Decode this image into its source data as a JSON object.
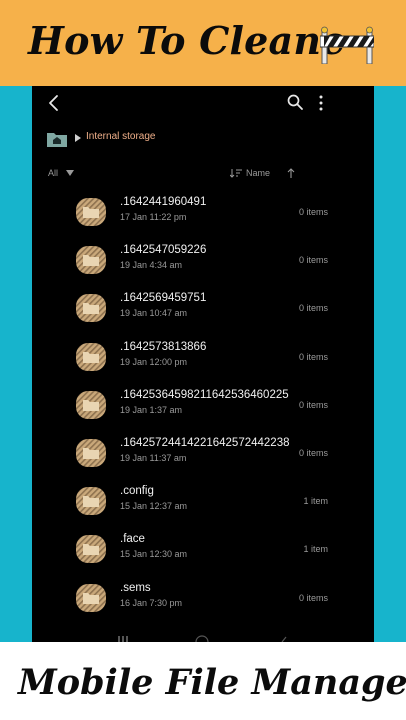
{
  "banner_top": {
    "title": "How To Cleane",
    "icon": "road-barrier-icon"
  },
  "banner_bottom": {
    "title": "Mobile File Manager"
  },
  "colors": {
    "accent_orange": "#f6b14a",
    "side_cyan": "#17b4cc",
    "folder": "#c9a87a",
    "breadcrumb": "#f0b08a"
  },
  "toolbar": {
    "back_icon": "back-chevron-icon",
    "search_icon": "search-icon",
    "more_icon": "more-vertical-icon"
  },
  "breadcrumb": {
    "home_icon": "home-folder-icon",
    "label": "Internal storage"
  },
  "filter": {
    "label": "All"
  },
  "sort": {
    "label": "Name",
    "direction": "ascending"
  },
  "files": [
    {
      "name": ".1642441960491",
      "date": "17 Jan 11:22 pm",
      "count": "0 items"
    },
    {
      "name": ".1642547059226",
      "date": "19 Jan 4:34 am",
      "count": "0 items"
    },
    {
      "name": ".1642569459751",
      "date": "19 Jan 10:47 am",
      "count": "0 items"
    },
    {
      "name": ".1642573813866",
      "date": "19 Jan 12:00 pm",
      "count": "0 items"
    },
    {
      "name": ".16425364598211642536460225",
      "date": "19 Jan 1:37 am",
      "count": "0 items"
    },
    {
      "name": ".16425724414221642572442238",
      "date": "19 Jan 11:37 am",
      "count": "0 items"
    },
    {
      "name": ".config",
      "date": "15 Jan 12:37 am",
      "count": "1 item"
    },
    {
      "name": ".face",
      "date": "15 Jan 12:30 am",
      "count": "1 item"
    },
    {
      "name": ".sems",
      "date": "16 Jan 7:30 pm",
      "count": "0 items"
    }
  ]
}
